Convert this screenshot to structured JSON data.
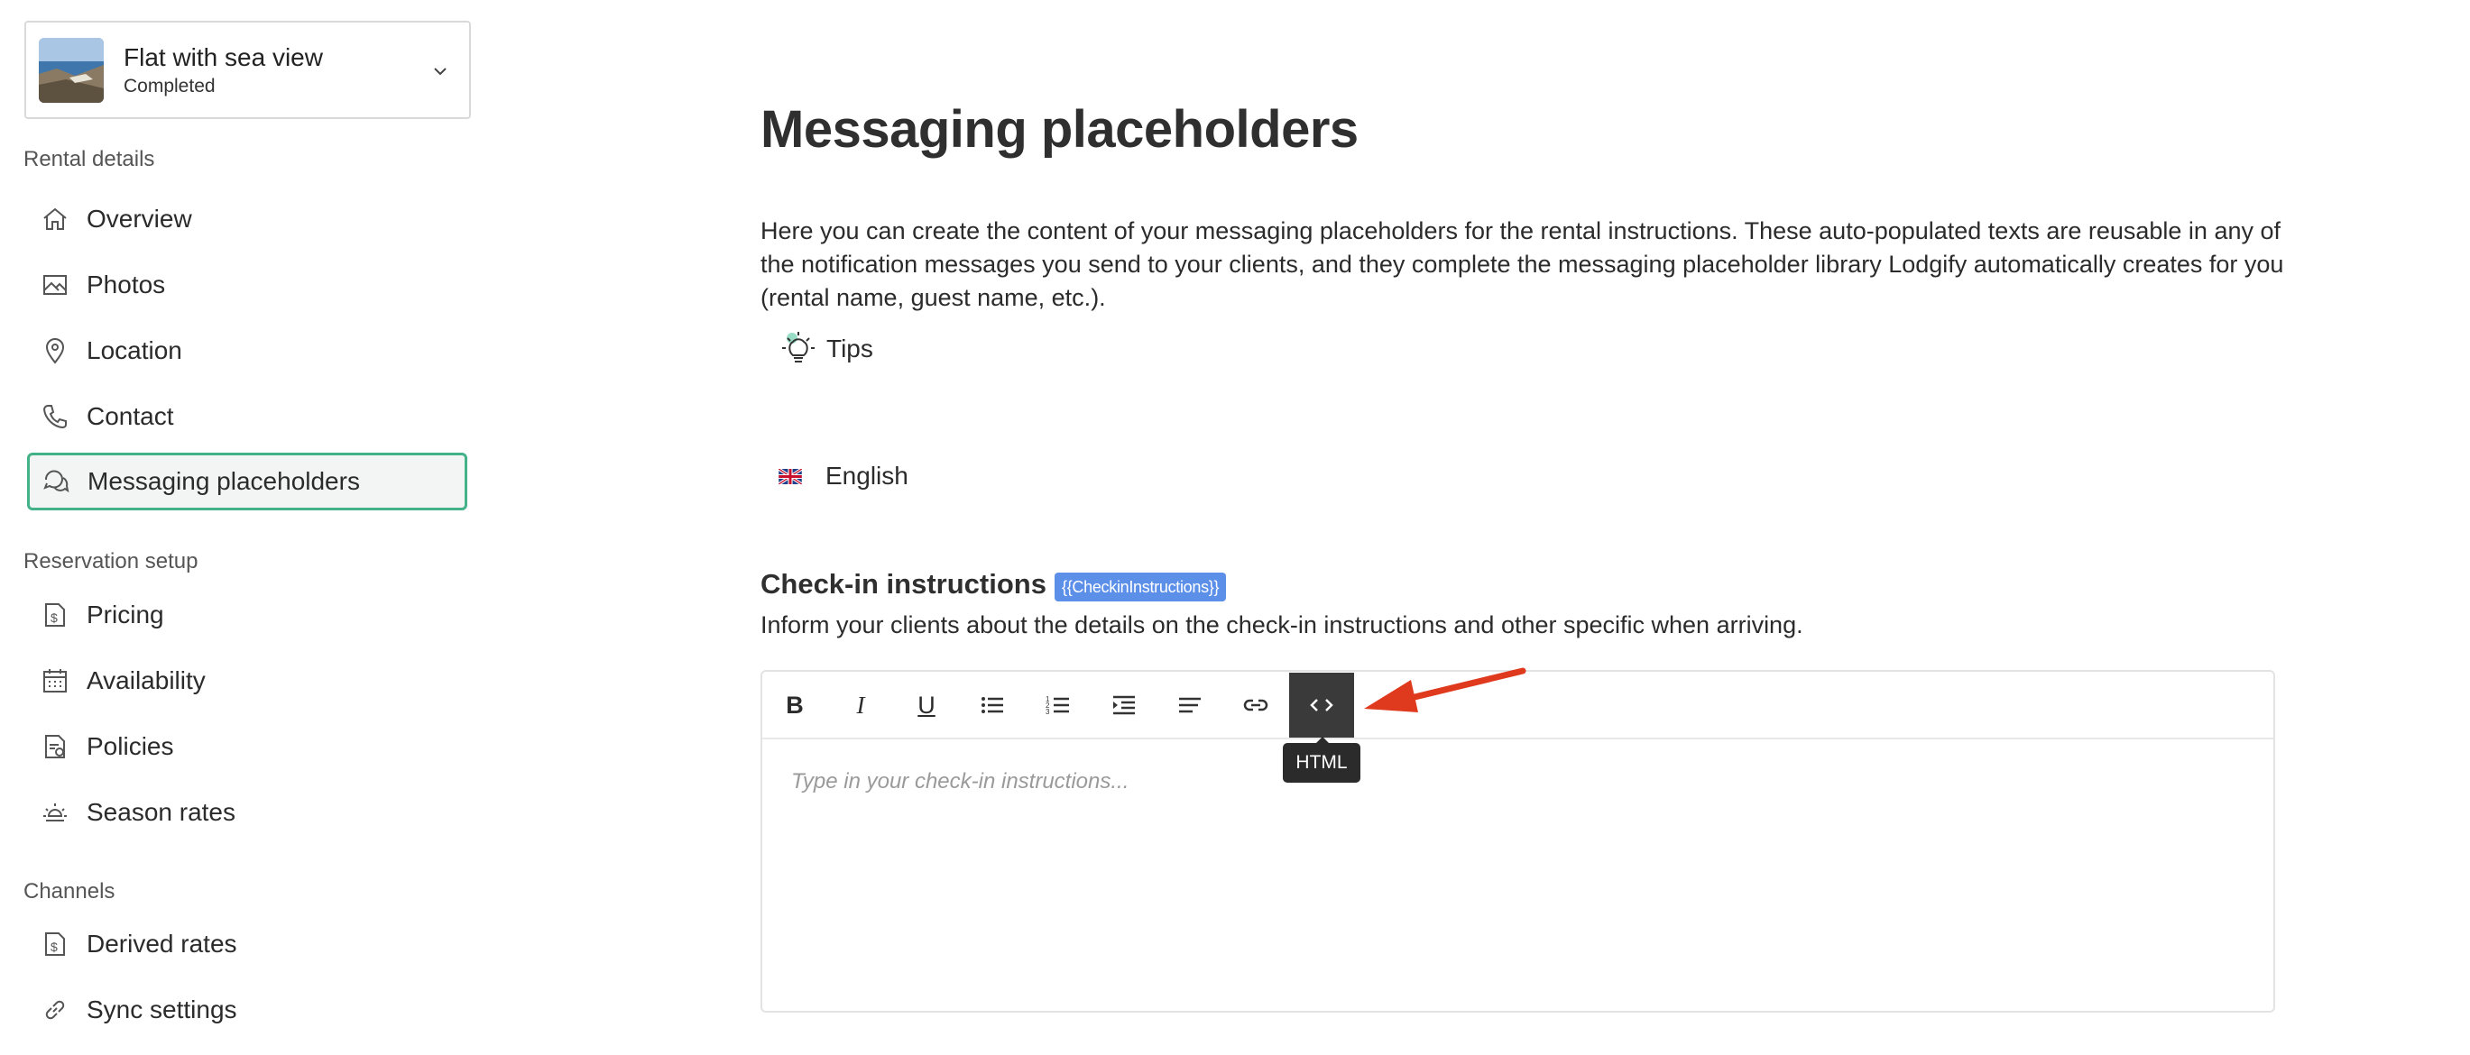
{
  "rental": {
    "name": "Flat with sea view",
    "status": "Completed"
  },
  "sidebar": {
    "sections": [
      {
        "label": "Rental details"
      },
      {
        "label": "Reservation setup"
      },
      {
        "label": "Channels"
      }
    ],
    "items": [
      {
        "label": "Overview",
        "icon": "home-icon"
      },
      {
        "label": "Photos",
        "icon": "image-icon"
      },
      {
        "label": "Location",
        "icon": "location-pin-icon"
      },
      {
        "label": "Contact",
        "icon": "phone-icon"
      },
      {
        "label": "Messaging placeholders",
        "icon": "chat-bubbles-icon",
        "active": true
      },
      {
        "label": "Pricing",
        "icon": "pricing-icon"
      },
      {
        "label": "Availability",
        "icon": "calendar-icon"
      },
      {
        "label": "Policies",
        "icon": "policy-document-icon"
      },
      {
        "label": "Season rates",
        "icon": "sun-icon"
      },
      {
        "label": "Derived rates",
        "icon": "derived-rates-icon"
      },
      {
        "label": "Sync settings",
        "icon": "link-icon"
      }
    ]
  },
  "main": {
    "title": "Messaging placeholders",
    "intro": "Here you can create the content of your messaging placeholders for the rental instructions. These auto-populated texts are reusable in any of the notification messages you send to your clients, and they complete the messaging placeholder library Lodgify automatically creates for you (rental name, guest name, etc.).",
    "tips_label": "Tips",
    "language": "English",
    "checkin": {
      "title": "Check-in instructions",
      "tag": "{{CheckinInstructions}}",
      "description": "Inform your clients about the details on the check-in instructions and other specific when arriving.",
      "placeholder": "Type in your check-in instructions...",
      "toolbar": {
        "bold": "B",
        "italic": "I",
        "underline": "U",
        "html_tooltip": "HTML"
      }
    }
  },
  "colors": {
    "accent": "#43b288",
    "tag": "#5b8fe8",
    "annotation_arrow": "#e03a1e"
  }
}
